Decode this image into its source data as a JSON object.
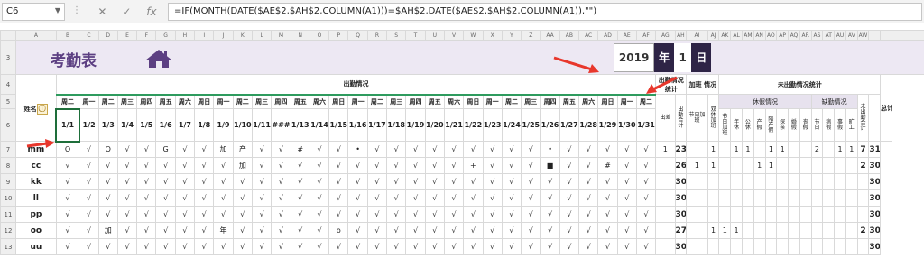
{
  "formula_bar": {
    "name_box": "C6",
    "dots": "⋮",
    "cancel_icon": "✕",
    "confirm_icon": "✓",
    "fx_icon": "fx",
    "formula": "=IF(MONTH(DATE($AE$2,$AH$2,COLUMN(A1)))=$AH$2,DATE($AE$2,$AH$2,COLUMN(A1)),\"\")"
  },
  "columns": [
    "A",
    "B",
    "C",
    "D",
    "E",
    "F",
    "G",
    "H",
    "I",
    "J",
    "K",
    "L",
    "M",
    "N",
    "O",
    "P",
    "Q",
    "R",
    "S",
    "T",
    "U",
    "V",
    "W",
    "X",
    "Y",
    "Z",
    "AA",
    "AB",
    "AC",
    "AD",
    "AE",
    "AF",
    "AG",
    "AH",
    "AI",
    "AJ",
    "AK",
    "AL",
    "AM",
    "AN",
    "AO",
    "AP",
    "AQ",
    "AR",
    "AS",
    "AT",
    "AU",
    "AV",
    "AW",
    ""
  ],
  "rows": [
    "1",
    "3",
    "4",
    "5",
    "6",
    "7",
    "8",
    "9",
    "10",
    "11",
    "12",
    "13"
  ],
  "banner": {
    "title": "考勤表",
    "home_icon": "home-icon",
    "year": "2019",
    "year_label": "年",
    "month": "1",
    "day_label": "日"
  },
  "headers": {
    "name": "姓名",
    "attendance": "出勤情况",
    "attendance_stats": "出勤情况统计",
    "overtime_stats": "加班 情况",
    "absence_stats": "未出勤情况统计",
    "total": "总计",
    "leave": "休假情况",
    "work_leave": "缺勤情况"
  },
  "weekdays": [
    "周二",
    "周一",
    "周二",
    "周三",
    "周四",
    "周五",
    "周六",
    "周日",
    "周一",
    "周二",
    "周三",
    "周四",
    "周五",
    "周六",
    "周日",
    "周一",
    "周二",
    "周三",
    "周四",
    "周五",
    "周六",
    "周日",
    "周一",
    "周二",
    "周三",
    "周四",
    "周五",
    "周六",
    "周日",
    "周一",
    "周二"
  ],
  "dates": [
    "1/1",
    "1/2",
    "1/3",
    "1/4",
    "1/5",
    "1/6",
    "1/7",
    "1/8",
    "1/9",
    "1/10",
    "1/11",
    "###",
    "1/13",
    "1/14",
    "1/15",
    "1/16",
    "1/17",
    "1/18",
    "1/19",
    "1/20",
    "1/21",
    "1/22",
    "1/23",
    "1/24",
    "1/25",
    "1/26",
    "1/27",
    "1/28",
    "1/29",
    "1/30",
    "1/31"
  ],
  "stat_cols": [
    "出差",
    "出勤合计",
    "节日加班",
    "双休加班",
    "节日加班",
    "年休",
    "公休",
    "产假",
    "陪产假",
    "探亲",
    "婚假",
    "丧假",
    "节日",
    "病假",
    "事假",
    "旷工",
    "未出勤合计"
  ],
  "name_badge": "ⓘ",
  "employees": [
    {
      "name": "mm",
      "marks": [
        "O",
        "√",
        "O",
        "√",
        "√",
        "G",
        "√",
        "√",
        "加",
        "产",
        "√",
        "√",
        "#",
        "√",
        "√",
        "•",
        "√",
        "√",
        "√",
        "√",
        "√",
        "√",
        "√",
        "√",
        "√",
        "•",
        "√",
        "√",
        "√",
        "√",
        "√"
      ],
      "stats": [
        "1",
        "23",
        "",
        "1",
        "",
        "1",
        "1",
        "",
        "1",
        "1",
        "",
        "",
        "2",
        "",
        "1",
        "1",
        "7"
      ],
      "total": "31"
    },
    {
      "name": "cc",
      "marks": [
        "√",
        "√",
        "√",
        "√",
        "√",
        "√",
        "√",
        "√",
        "√",
        "加",
        "√",
        "√",
        "√",
        "√",
        "√",
        "√",
        "√",
        "√",
        "√",
        "√",
        "√",
        "+",
        "√",
        "√",
        "√",
        "■",
        "√",
        "√",
        "#",
        "√",
        "√"
      ],
      "stats": [
        "",
        "26",
        "1",
        "1",
        "",
        "",
        "",
        "1",
        "1",
        "",
        "",
        "",
        "",
        "",
        "",
        "",
        "2"
      ],
      "total": "30"
    },
    {
      "name": "kk",
      "marks": [
        "√",
        "√",
        "√",
        "√",
        "√",
        "√",
        "√",
        "√",
        "√",
        "√",
        "√",
        "√",
        "√",
        "√",
        "√",
        "√",
        "√",
        "√",
        "√",
        "√",
        "√",
        "√",
        "√",
        "√",
        "√",
        "√",
        "√",
        "√",
        "√",
        "√",
        "√"
      ],
      "stats": [
        "",
        "30",
        "",
        "",
        "",
        "",
        "",
        "",
        "",
        "",
        "",
        "",
        "",
        "",
        "",
        "",
        ""
      ],
      "total": "30"
    },
    {
      "name": "ll",
      "marks": [
        "√",
        "√",
        "√",
        "√",
        "√",
        "√",
        "√",
        "√",
        "√",
        "√",
        "√",
        "√",
        "√",
        "√",
        "√",
        "√",
        "√",
        "√",
        "√",
        "√",
        "√",
        "√",
        "√",
        "√",
        "√",
        "√",
        "√",
        "√",
        "√",
        "√",
        "√"
      ],
      "stats": [
        "",
        "30",
        "",
        "",
        "",
        "",
        "",
        "",
        "",
        "",
        "",
        "",
        "",
        "",
        "",
        "",
        ""
      ],
      "total": "30"
    },
    {
      "name": "pp",
      "marks": [
        "√",
        "√",
        "√",
        "√",
        "√",
        "√",
        "√",
        "√",
        "√",
        "√",
        "√",
        "√",
        "√",
        "√",
        "√",
        "√",
        "√",
        "√",
        "√",
        "√",
        "√",
        "√",
        "√",
        "√",
        "√",
        "√",
        "√",
        "√",
        "√",
        "√",
        "√"
      ],
      "stats": [
        "",
        "30",
        "",
        "",
        "",
        "",
        "",
        "",
        "",
        "",
        "",
        "",
        "",
        "",
        "",
        "",
        ""
      ],
      "total": "30"
    },
    {
      "name": "oo",
      "marks": [
        "√",
        "√",
        "加",
        "√",
        "√",
        "√",
        "√",
        "√",
        "年",
        "√",
        "√",
        "√",
        "√",
        "√",
        "o",
        "√",
        "√",
        "√",
        "√",
        "√",
        "√",
        "√",
        "√",
        "√",
        "√",
        "√",
        "√",
        "√",
        "√",
        "√",
        "√"
      ],
      "stats": [
        "",
        "27",
        "",
        "1",
        "1",
        "1",
        "",
        "",
        "",
        "",
        "",
        "",
        "",
        "",
        "",
        "",
        "2"
      ],
      "total": "30"
    },
    {
      "name": "uu",
      "marks": [
        "√",
        "√",
        "√",
        "√",
        "√",
        "√",
        "√",
        "√",
        "√",
        "√",
        "√",
        "√",
        "√",
        "√",
        "√",
        "√",
        "√",
        "√",
        "√",
        "√",
        "√",
        "√",
        "√",
        "√",
        "√",
        "√",
        "√",
        "√",
        "√",
        "√",
        "√"
      ],
      "stats": [
        "",
        "30",
        "",
        "",
        "",
        "",
        "",
        "",
        "",
        "",
        "",
        "",
        "",
        "",
        "",
        "",
        ""
      ],
      "total": "30"
    }
  ],
  "colors": {
    "title": "#5c3f82",
    "band": "#ede8f3",
    "dark_box": "#2e2446",
    "arrow": "#e8372c",
    "weekday_border": "#2e9b5e"
  }
}
